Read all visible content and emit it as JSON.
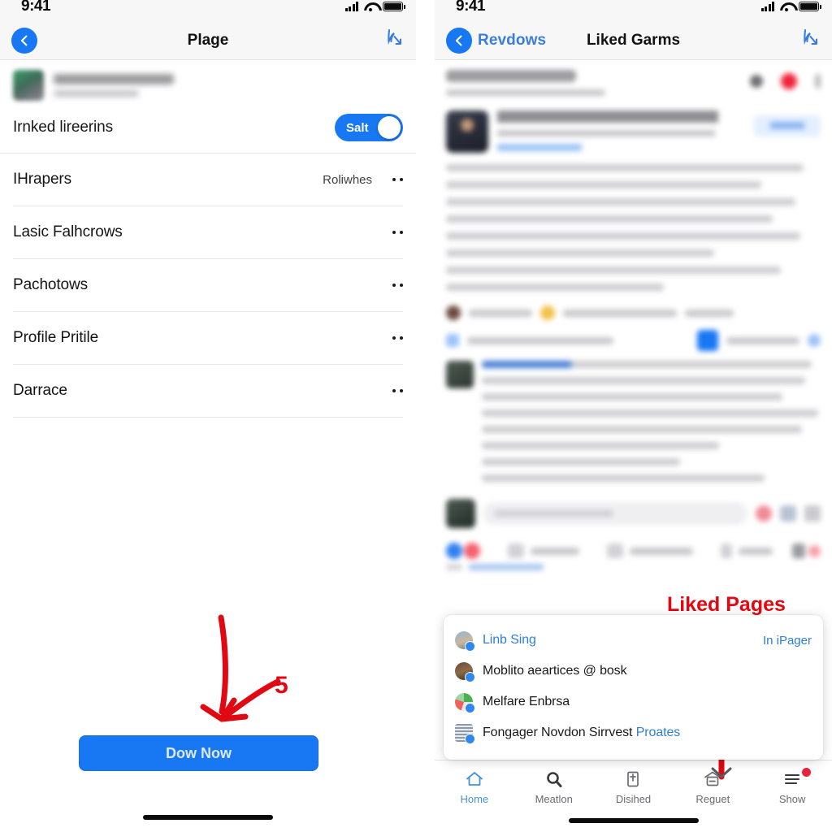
{
  "status_bar": {
    "time": "9:41"
  },
  "left_panel": {
    "nav": {
      "title": "Plage",
      "back_icon": "chevron-left-icon",
      "right_icon": "cursor-arrow-icon"
    },
    "toggle_row": {
      "label": "Irnked lireerins",
      "switch_text": "Salt",
      "switch_on": true
    },
    "list": [
      {
        "label": "IHrapers",
        "value": "Roliwhes",
        "chevron": "more-dots-icon"
      },
      {
        "label": "Lasic Falhcrows",
        "value": "",
        "chevron": "more-dots-icon"
      },
      {
        "label": "Pachotows",
        "value": "",
        "chevron": "more-dots-icon"
      },
      {
        "label": "Profile Pritile",
        "value": "",
        "chevron": "more-dots-icon"
      },
      {
        "label": "Darrace",
        "value": "",
        "chevron": "more-dots-icon"
      }
    ],
    "cta": {
      "label": "Dow Now"
    },
    "annotation": {
      "step": "5"
    }
  },
  "right_panel": {
    "nav": {
      "back_label": "Revdows",
      "title": "Liked Garms",
      "back_icon": "chevron-left-icon",
      "right_icon": "cursor-arrow-icon"
    },
    "annotation": {
      "callout": "Liked Pages"
    },
    "dropdown": {
      "right_action": "In iPager",
      "items": [
        {
          "label": "Linb Sing",
          "accent": "",
          "style": "link",
          "avatar": "person-avatar-1"
        },
        {
          "label": "Moblito aeartices @ bosk",
          "accent": "",
          "style": "plain",
          "avatar": "person-avatar-2"
        },
        {
          "label": "Melfare Enbrsa",
          "accent": "",
          "style": "plain",
          "avatar": "globe-avatar"
        },
        {
          "label": "Fongager Novdon Sirrvest ",
          "accent": "Proates",
          "style": "plain",
          "avatar": "grid-avatar"
        }
      ]
    },
    "tabbar": [
      {
        "label": "Home",
        "icon": "home-icon",
        "active": true,
        "badge": false
      },
      {
        "label": "Meatlon",
        "icon": "search-icon",
        "active": false,
        "badge": false
      },
      {
        "label": "Disihed",
        "icon": "clipboard-icon",
        "active": false,
        "badge": false
      },
      {
        "label": "Reguet",
        "icon": "store-icon",
        "active": false,
        "badge": false
      },
      {
        "label": "Show",
        "icon": "menu-icon",
        "active": false,
        "badge": true
      }
    ]
  },
  "colors": {
    "accent_blue": "#1877f2",
    "link_blue": "#2f7fd6",
    "annotation_red": "#e00812",
    "bar_background": "#f7f7f8"
  }
}
